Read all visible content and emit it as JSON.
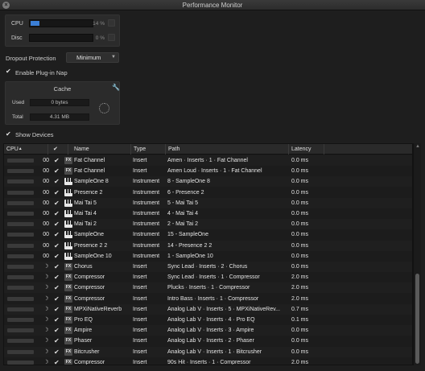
{
  "window": {
    "title": "Performance Monitor"
  },
  "meters": {
    "cpu": {
      "label": "CPU",
      "value_text": "14 %",
      "fraction": 0.14,
      "color": "#3b7fd6"
    },
    "disc": {
      "label": "Disc",
      "value_text": "0 %",
      "fraction": 0.0
    }
  },
  "dropout": {
    "label": "Dropout Protection",
    "value": "Minimum"
  },
  "plugin_nap": {
    "label": "Enable Plug-in Nap",
    "checked": true
  },
  "cache": {
    "title": "Cache",
    "used_label": "Used",
    "used_value": "0 bytes",
    "total_label": "Total",
    "total_value": "4.31 MB"
  },
  "show_devices": {
    "label": "Show Devices",
    "checked": true
  },
  "table": {
    "columns": {
      "cpu": "CPU",
      "check": "✔",
      "name": "Name",
      "type": "Type",
      "path": "Path",
      "latency": "Latency"
    },
    "rows": [
      {
        "cpu": "00",
        "moon": false,
        "icon": "fx",
        "name": "Fat Channel",
        "type": "Insert",
        "path": "Amen · Inserts · 1 · Fat Channel",
        "latency": "0.0 ms"
      },
      {
        "cpu": "00",
        "moon": false,
        "icon": "fx",
        "name": "Fat Channel",
        "type": "Insert",
        "path": "Amen Loud · Inserts · 1 · Fat Channel",
        "latency": "0.0 ms"
      },
      {
        "cpu": "00",
        "moon": false,
        "icon": "inst",
        "name": "SampleOne 8",
        "type": "Instrument",
        "path": "8 - SampleOne 8",
        "latency": "0.0 ms"
      },
      {
        "cpu": "00",
        "moon": false,
        "icon": "inst",
        "name": "Presence 2",
        "type": "Instrument",
        "path": "6 - Presence 2",
        "latency": "0.0 ms"
      },
      {
        "cpu": "00",
        "moon": false,
        "icon": "inst",
        "name": "Mai Tai 5",
        "type": "Instrument",
        "path": "5 - Mai Tai 5",
        "latency": "0.0 ms"
      },
      {
        "cpu": "00",
        "moon": false,
        "icon": "inst",
        "name": "Mai Tai 4",
        "type": "Instrument",
        "path": "4 - Mai Tai 4",
        "latency": "0.0 ms"
      },
      {
        "cpu": "00",
        "moon": false,
        "icon": "inst",
        "name": "Mai Tai 2",
        "type": "Instrument",
        "path": "2 - Mai Tai 2",
        "latency": "0.0 ms"
      },
      {
        "cpu": "00",
        "moon": false,
        "icon": "inst",
        "name": "SampleOne",
        "type": "Instrument",
        "path": "15 - SampleOne",
        "latency": "0.0 ms"
      },
      {
        "cpu": "00",
        "moon": false,
        "icon": "inst",
        "name": "Presence 2 2",
        "type": "Instrument",
        "path": "14 - Presence 2 2",
        "latency": "0.0 ms"
      },
      {
        "cpu": "00",
        "moon": false,
        "icon": "inst",
        "name": "SampleOne 10",
        "type": "Instrument",
        "path": "1 - SampleOne 10",
        "latency": "0.0 ms"
      },
      {
        "cpu": "",
        "moon": true,
        "icon": "fx",
        "name": "Chorus",
        "type": "Insert",
        "path": "Sync Lead · Inserts · 2 · Chorus",
        "latency": "0.0 ms"
      },
      {
        "cpu": "",
        "moon": true,
        "icon": "fx",
        "name": "Compressor",
        "type": "Insert",
        "path": "Sync Lead · Inserts · 1 · Compressor",
        "latency": "2.0 ms"
      },
      {
        "cpu": "",
        "moon": true,
        "icon": "fx",
        "name": "Compressor",
        "type": "Insert",
        "path": "Plucks · Inserts · 1 · Compressor",
        "latency": "2.0 ms"
      },
      {
        "cpu": "",
        "moon": true,
        "icon": "fx",
        "name": "Compressor",
        "type": "Insert",
        "path": "Intro Bass · Inserts · 1 · Compressor",
        "latency": "2.0 ms"
      },
      {
        "cpu": "",
        "moon": true,
        "icon": "fx",
        "name": "MPXiNativeReverb",
        "type": "Insert",
        "path": "Analog Lab V · Inserts · 5 · MPXiNativeRev...",
        "latency": "0.7 ms"
      },
      {
        "cpu": "",
        "moon": true,
        "icon": "fx",
        "name": "Pro EQ",
        "type": "Insert",
        "path": "Analog Lab V · Inserts · 4 · Pro EQ",
        "latency": "0.1 ms"
      },
      {
        "cpu": "",
        "moon": true,
        "icon": "fx",
        "name": "Ampire",
        "type": "Insert",
        "path": "Analog Lab V · Inserts · 3 · Ampire",
        "latency": "0.0 ms"
      },
      {
        "cpu": "",
        "moon": true,
        "icon": "fx",
        "name": "Phaser",
        "type": "Insert",
        "path": "Analog Lab V · Inserts · 2 · Phaser",
        "latency": "0.0 ms"
      },
      {
        "cpu": "",
        "moon": true,
        "icon": "fx",
        "name": "Bitcrusher",
        "type": "Insert",
        "path": "Analog Lab V · Inserts · 1 · Bitcrusher",
        "latency": "0.0 ms"
      },
      {
        "cpu": "",
        "moon": true,
        "icon": "fx",
        "name": "Compressor",
        "type": "Insert",
        "path": "90s Hit · Inserts · 1 · Compressor",
        "latency": "2.0 ms"
      }
    ]
  },
  "icons": {
    "close": "close-icon",
    "wrench": "wrench-icon",
    "fx": "fx-icon",
    "instrument": "keyboard-icon",
    "moon": "nap-moon-icon"
  }
}
